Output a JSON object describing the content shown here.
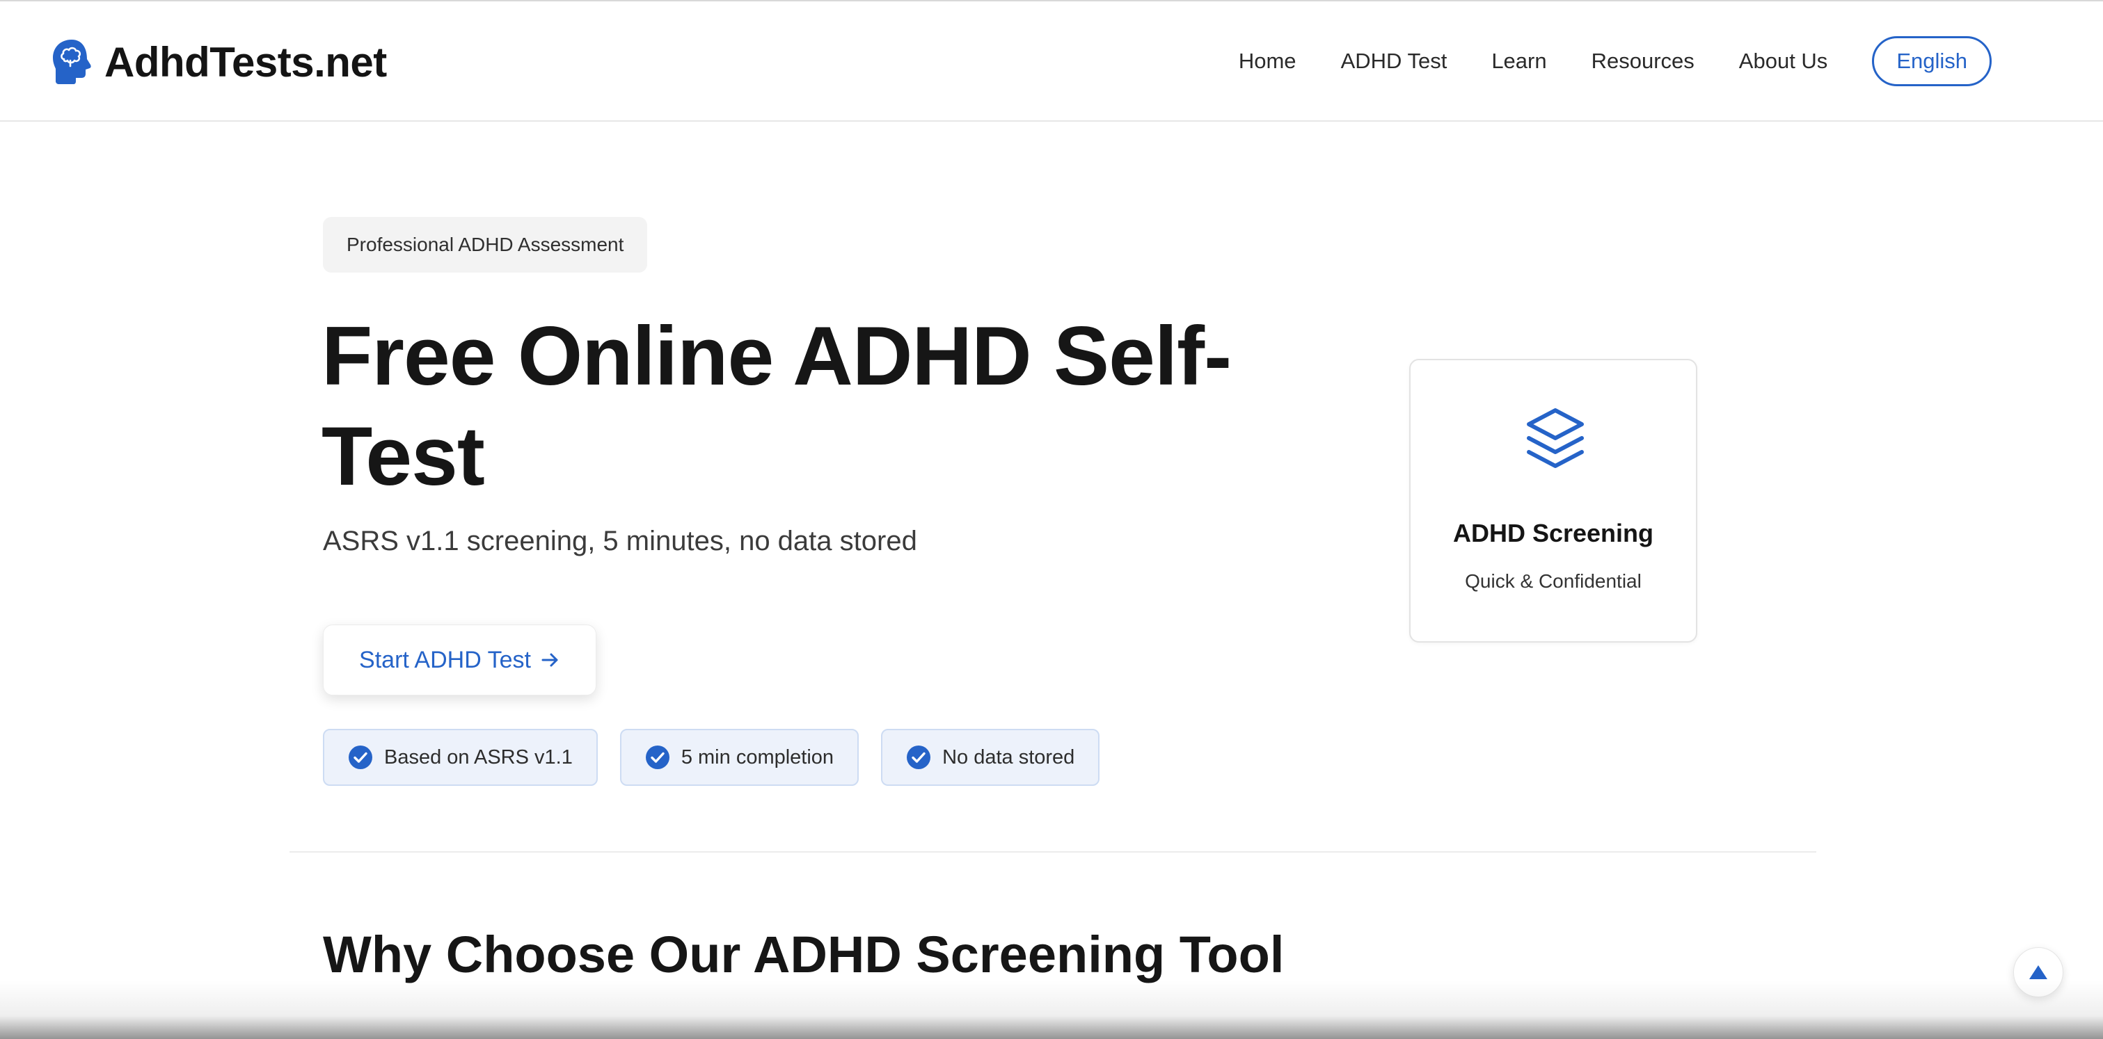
{
  "brand": {
    "name": "AdhdTests.net",
    "icon": "brain-head-icon",
    "accent_color": "#2563c8"
  },
  "nav": {
    "items": [
      "Home",
      "ADHD Test",
      "Learn",
      "Resources",
      "About Us"
    ],
    "language": "English"
  },
  "hero": {
    "badge": "Professional ADHD Assessment",
    "title": "Free Online ADHD Self-Test",
    "subtitle": "ASRS v1.1 screening, 5 minutes, no data stored",
    "cta_label": "Start ADHD Test",
    "cta_icon": "arrow-right-icon",
    "features": [
      {
        "label": "Based on ASRS v1.1",
        "icon": "check-circle-icon"
      },
      {
        "label": "5 min completion",
        "icon": "check-circle-icon"
      },
      {
        "label": "No data stored",
        "icon": "check-circle-icon"
      }
    ]
  },
  "card": {
    "icon": "layers-icon",
    "title": "ADHD Screening",
    "subtitle": "Quick & Confidential"
  },
  "section": {
    "title": "Why Choose Our ADHD Screening Tool"
  },
  "scroll_top": {
    "icon": "triangle-up-icon"
  }
}
